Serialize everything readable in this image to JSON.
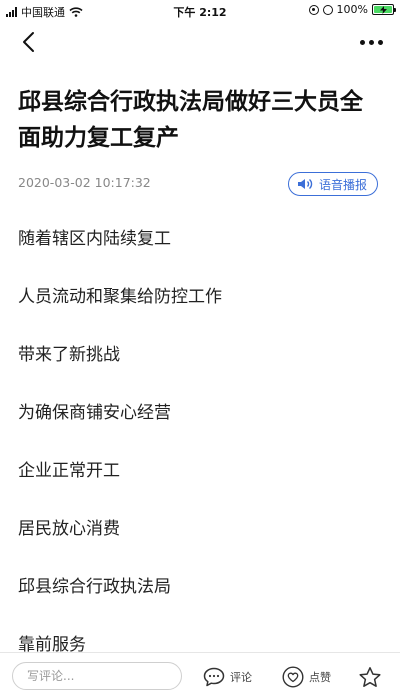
{
  "status_bar": {
    "carrier": "中国联通",
    "time": "下午 2:12",
    "battery": "100%",
    "battery_level": 1.0
  },
  "nav": {
    "back_icon": "chevron-left-icon",
    "more_icon": "more-dots-icon"
  },
  "article": {
    "title": "邱县综合行政执法局做好三大员全面助力复工复产",
    "publish_time": "2020-03-02 10:17:32",
    "tts_label": "语音播报",
    "paragraphs": [
      "随着辖区内陆续复工",
      "人员流动和聚集给防控工作",
      "带来了新挑战",
      "为确保商铺安心经营",
      "企业正常开工",
      "居民放心消费",
      "邱县综合行政执法局",
      "靠前服务"
    ]
  },
  "bottom_bar": {
    "comment_placeholder": "写评论...",
    "comment_label": "评论",
    "like_label": "点赞"
  },
  "colors": {
    "accent": "#3c6fd8",
    "text": "#222222",
    "meta": "#888888"
  }
}
